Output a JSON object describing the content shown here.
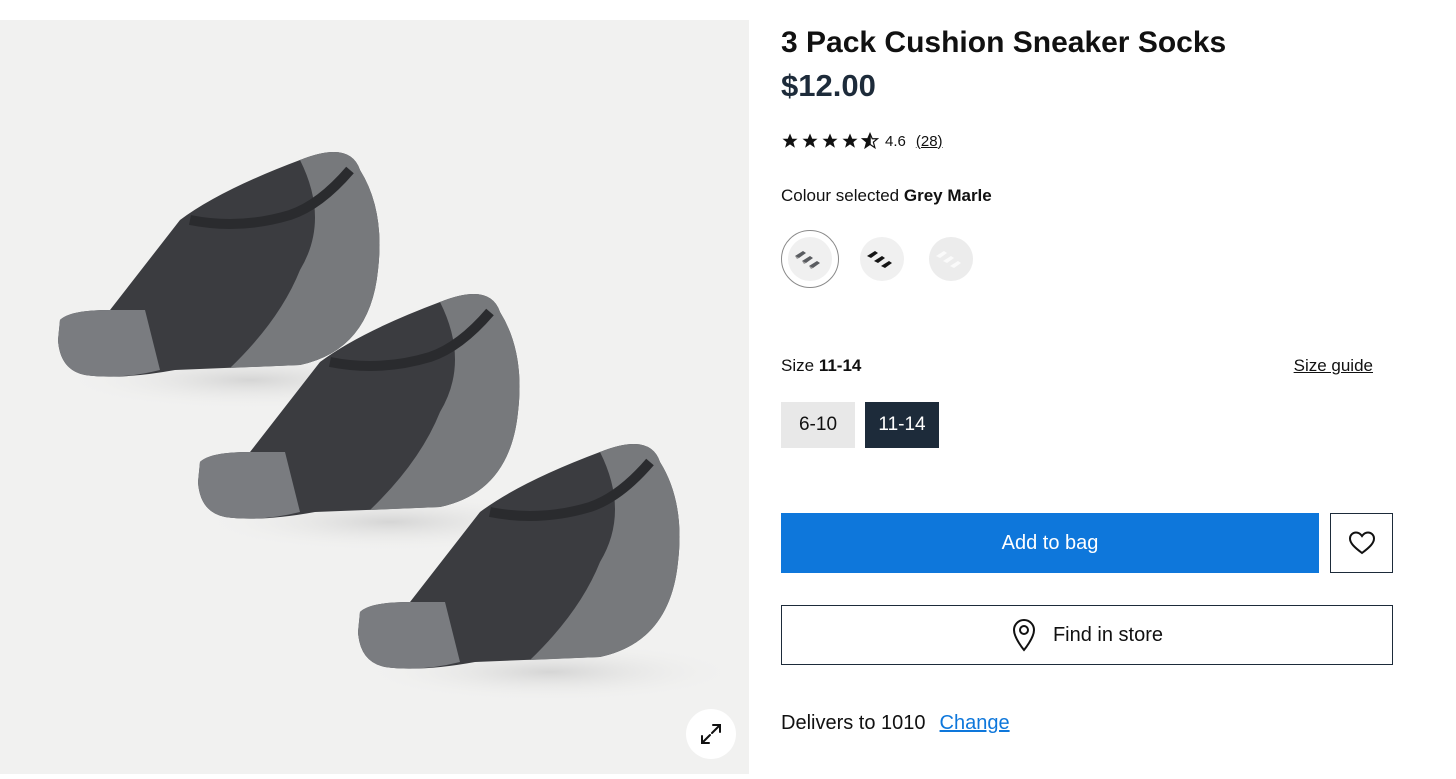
{
  "product": {
    "title": "3 Pack Cushion Sneaker Socks",
    "price": "$12.00"
  },
  "rating": {
    "value": "4.6",
    "count": "(28)",
    "stars": 4.6
  },
  "colour": {
    "label": "Colour selected",
    "selected": "Grey Marle",
    "swatches": [
      {
        "name": "Grey Marle",
        "selected": true,
        "tone": "#5a5c60"
      },
      {
        "name": "Black",
        "selected": false,
        "tone": "#151515"
      },
      {
        "name": "White",
        "selected": false,
        "tone": "#fafafa"
      }
    ]
  },
  "size": {
    "label": "Size",
    "selected": "11-14",
    "guide_label": "Size guide",
    "options": [
      "6-10",
      "11-14"
    ]
  },
  "actions": {
    "add_to_bag": "Add to bag",
    "find_in_store": "Find in store"
  },
  "delivery": {
    "text": "Delivers to 1010",
    "change": "Change"
  },
  "icons": {
    "expand": "expand-icon",
    "heart": "heart-icon",
    "location": "location-pin-icon",
    "star": "star-icon"
  },
  "colors": {
    "primary": "#0e77db",
    "dark": "#1d2b3a"
  }
}
